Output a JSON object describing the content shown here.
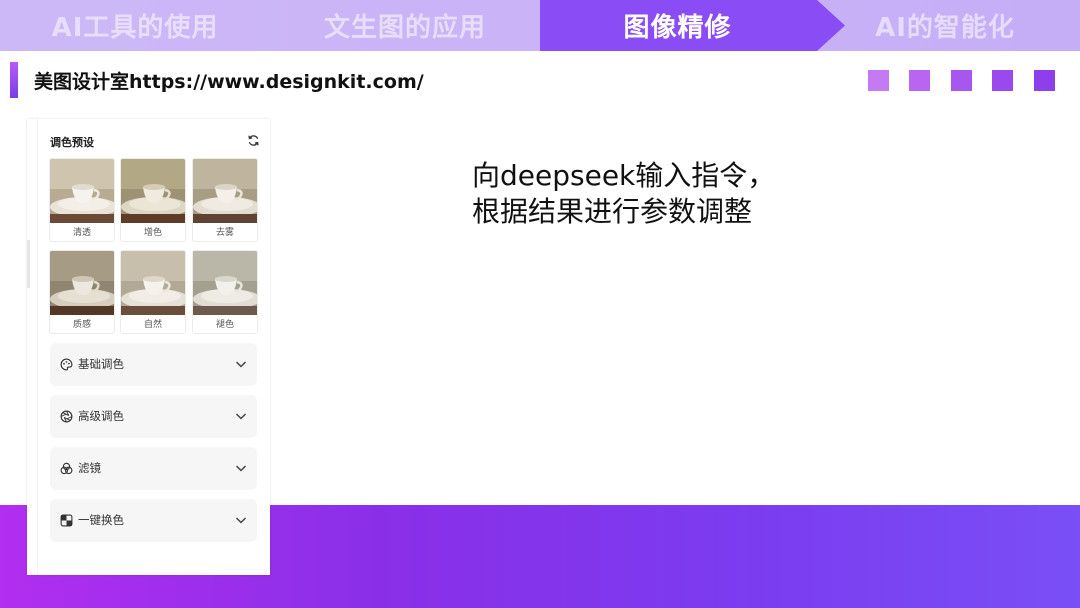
{
  "nav": {
    "tabs": [
      {
        "label": "AI工具的使用",
        "active": false
      },
      {
        "label": "文生图的应用",
        "active": false
      },
      {
        "label": "图像精修",
        "active": true
      },
      {
        "label": "AI的智能化",
        "active": false
      }
    ]
  },
  "header": {
    "title": "美图设计室https://www.designkit.com/"
  },
  "decor": {
    "square_colors": [
      "#c47af2",
      "#b866f1",
      "#a557f0",
      "#9a49ee",
      "#8d3feb"
    ]
  },
  "panel": {
    "preset_title": "调色预设",
    "presets": [
      {
        "label": "清透"
      },
      {
        "label": "增色"
      },
      {
        "label": "去雾"
      },
      {
        "label": "质感"
      },
      {
        "label": "自然"
      },
      {
        "label": "褪色"
      }
    ],
    "sections": [
      {
        "label": "基础调色",
        "icon": "palette-icon"
      },
      {
        "label": "高级调色",
        "icon": "aperture-icon"
      },
      {
        "label": "滤镜",
        "icon": "filter-icon"
      },
      {
        "label": "一键换色",
        "icon": "color-swap-icon"
      }
    ]
  },
  "content": {
    "line1": "向deepseek输入指令，",
    "line2": "根据结果进行参数调整"
  },
  "colors": {
    "accent": "#8a4cf4",
    "nav_bg": "#cdb8f7",
    "band_start": "#b22ef0",
    "band_end": "#7a4ff6"
  }
}
